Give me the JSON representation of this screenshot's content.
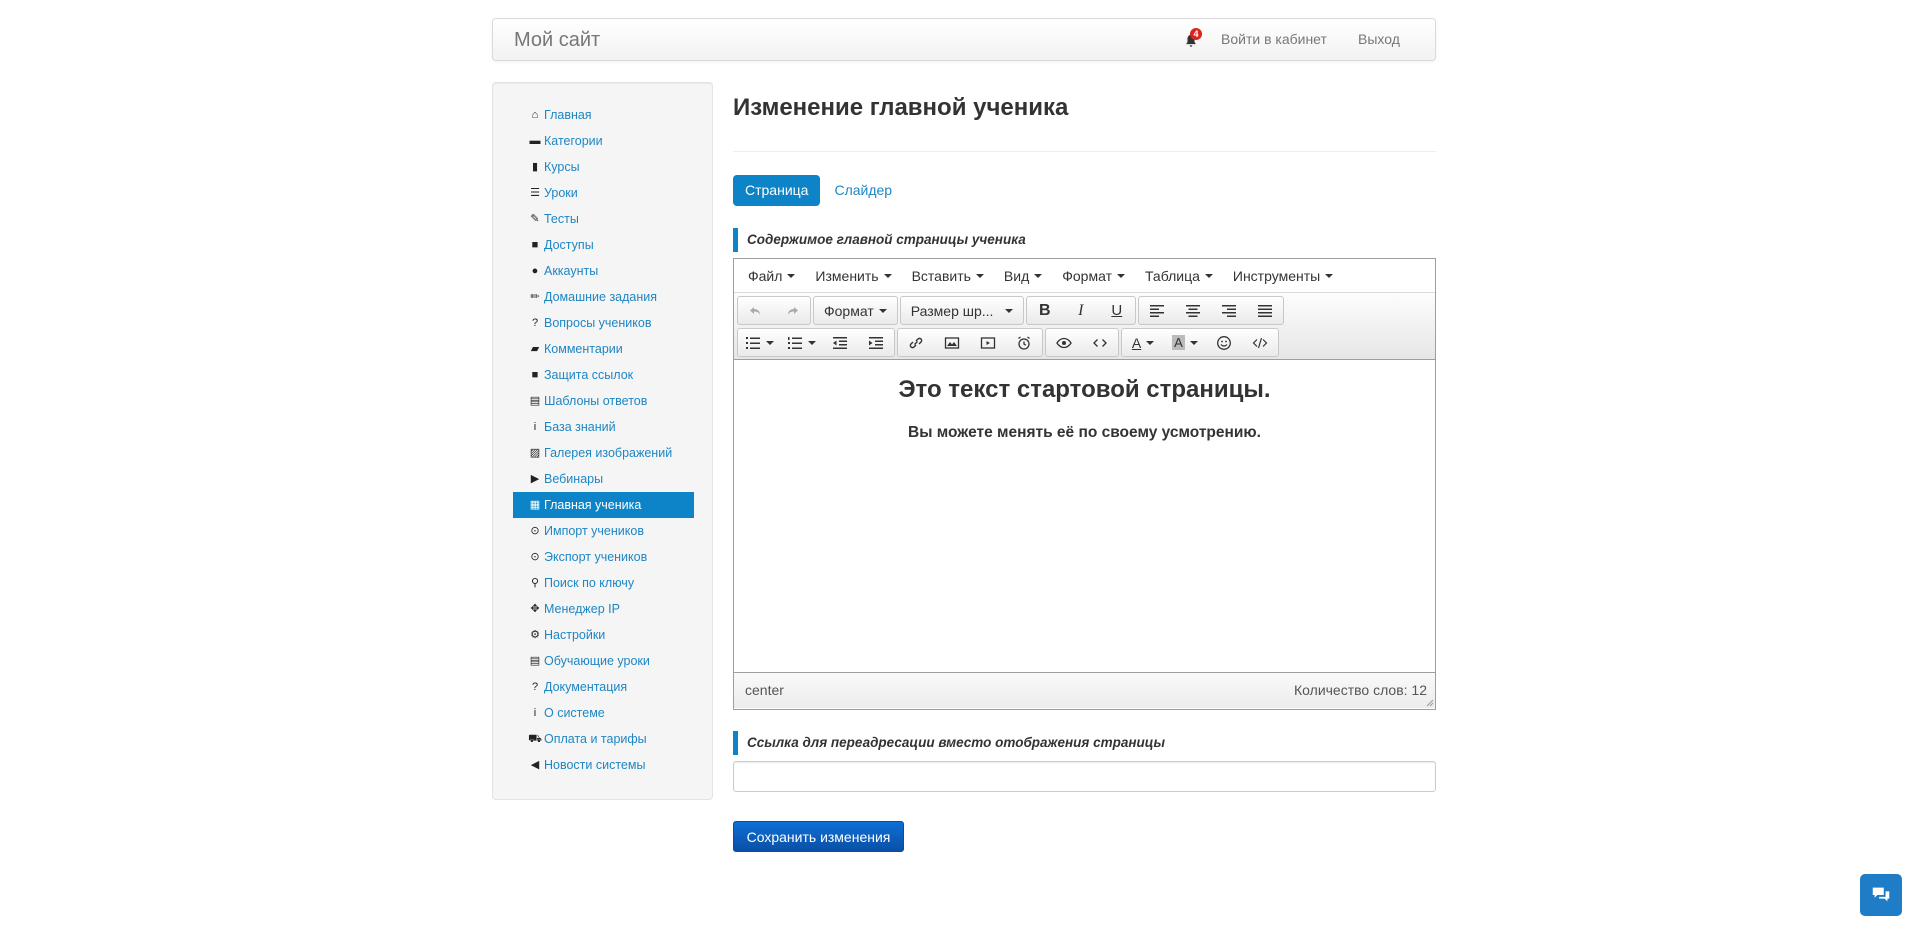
{
  "navbar": {
    "brand": "Мой сайт",
    "notifications_count": "4",
    "cabinet_link": "Войти в кабинет",
    "exit_link": "Выход"
  },
  "sidebar": {
    "items": [
      {
        "label": "Главная",
        "icon": "home-icon",
        "glyph": "⌂"
      },
      {
        "label": "Категории",
        "icon": "folder-icon",
        "glyph": "▬"
      },
      {
        "label": "Курсы",
        "icon": "book-icon",
        "glyph": "▮"
      },
      {
        "label": "Уроки",
        "icon": "list-icon",
        "glyph": "☰"
      },
      {
        "label": "Тесты",
        "icon": "edit-icon",
        "glyph": "✎"
      },
      {
        "label": "Доступы",
        "icon": "lock-icon",
        "glyph": "■"
      },
      {
        "label": "Аккаунты",
        "icon": "user-icon",
        "glyph": "●"
      },
      {
        "label": "Домашние задания",
        "icon": "pencil-icon",
        "glyph": "✏"
      },
      {
        "label": "Вопросы учеников",
        "icon": "question-icon",
        "glyph": "?"
      },
      {
        "label": "Комментарии",
        "icon": "comment-icon",
        "glyph": "▰"
      },
      {
        "label": "Защита ссылок",
        "icon": "lock-icon",
        "glyph": "■"
      },
      {
        "label": "Шаблоны ответов",
        "icon": "list-alt-icon",
        "glyph": "▤"
      },
      {
        "label": "База знаний",
        "icon": "info-icon",
        "glyph": "i"
      },
      {
        "label": "Галерея изображений",
        "icon": "picture-icon",
        "glyph": "▨"
      },
      {
        "label": "Вебинары",
        "icon": "play-icon",
        "glyph": "▶"
      },
      {
        "label": "Главная ученика",
        "icon": "dashboard-icon",
        "glyph": "▦"
      },
      {
        "label": "Импорт учеников",
        "icon": "import-icon",
        "glyph": "⊙"
      },
      {
        "label": "Экспорт учеников",
        "icon": "export-icon",
        "glyph": "⊙"
      },
      {
        "label": "Поиск по ключу",
        "icon": "search-icon",
        "glyph": "⚲"
      },
      {
        "label": "Менеджер IP",
        "icon": "move-icon",
        "glyph": "✥"
      },
      {
        "label": "Настройки",
        "icon": "gear-icon",
        "glyph": "⚙"
      },
      {
        "label": "Обучающие уроки",
        "icon": "film-icon",
        "glyph": "▤"
      },
      {
        "label": "Документация",
        "icon": "question-icon",
        "glyph": "?"
      },
      {
        "label": "О системе",
        "icon": "info-icon",
        "glyph": "i"
      },
      {
        "label": "Оплата и тарифы",
        "icon": "cart-icon",
        "glyph": "⛟"
      },
      {
        "label": "Новости системы",
        "icon": "bullhorn-icon",
        "glyph": "◀"
      }
    ],
    "active_index": 15
  },
  "main": {
    "title": "Изменение главной ученика",
    "tabs": [
      "Страница",
      "Слайдер"
    ],
    "content_label": "Содержимое главной страницы ученика",
    "redirect_label": "Ссылка для переадресации вместо отображения страницы",
    "redirect_value": "",
    "save_label": "Сохранить изменения"
  },
  "editor": {
    "menu": [
      "Файл",
      "Изменить",
      "Вставить",
      "Вид",
      "Формат",
      "Таблица",
      "Инструменты"
    ],
    "format_select": "Формат",
    "size_select": "Размер шр...",
    "heading": "Это текст стартовой страницы.",
    "paragraph": "Вы можете менять её по своему усмотрению.",
    "status_path": "center",
    "word_count": "Количество слов: 12"
  },
  "colors": {
    "accent": "#0c84c7",
    "link": "#1e86c4",
    "save_button": "#0a5fc0",
    "badge": "#d9251b",
    "chat_button": "#1f7cc6"
  }
}
